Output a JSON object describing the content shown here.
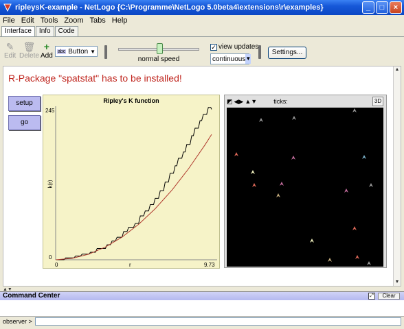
{
  "window": {
    "title": "ripleysK-example - NetLogo {C:\\Programme\\NetLogo 5.0beta4\\extensions\\r\\examples}"
  },
  "menu": [
    "File",
    "Edit",
    "Tools",
    "Zoom",
    "Tabs",
    "Help"
  ],
  "tabs": [
    {
      "label": "Interface",
      "active": true
    },
    {
      "label": "Info",
      "active": false
    },
    {
      "label": "Code",
      "active": false
    }
  ],
  "toolbar": {
    "edit_label": "Edit",
    "delete_label": "Delete",
    "add_label": "Add",
    "widget_tag": "abc",
    "widget_type": "Button",
    "speed_label": "normal speed",
    "speed_level": 0.5,
    "view_updates_label": "view updates",
    "view_updates_checked": true,
    "update_mode": "continuous",
    "settings_label": "Settings..."
  },
  "interface": {
    "error_message": "R-Package \"spatstat\" has to be installed!",
    "setup_label": "setup",
    "go_label": "go"
  },
  "chart_data": {
    "type": "line",
    "title": "Ripley's K function",
    "xlabel": "r",
    "ylabel": "k(r)",
    "xlim": [
      0,
      9.73
    ],
    "ylim": [
      0,
      245
    ],
    "x_min_label": "0",
    "x_max_label": "9.73",
    "y_min_label": "0",
    "y_max_label": "245",
    "series": [
      {
        "values": [
          [
            0,
            0
          ],
          [
            0.5,
            0
          ],
          [
            0.6,
            3
          ],
          [
            1.1,
            3
          ],
          [
            1.2,
            6
          ],
          [
            1.5,
            6
          ],
          [
            1.6,
            9
          ],
          [
            2.0,
            9
          ],
          [
            2.1,
            12
          ],
          [
            2.4,
            12
          ],
          [
            2.5,
            18
          ],
          [
            3.0,
            18
          ],
          [
            3.1,
            24
          ],
          [
            3.3,
            24
          ],
          [
            3.4,
            30
          ],
          [
            3.6,
            30
          ],
          [
            3.7,
            36
          ],
          [
            4.0,
            36
          ],
          [
            4.1,
            45
          ],
          [
            4.3,
            45
          ],
          [
            4.4,
            52
          ],
          [
            4.7,
            52
          ],
          [
            4.8,
            58
          ],
          [
            5.0,
            58
          ],
          [
            5.1,
            70
          ],
          [
            5.3,
            70
          ],
          [
            5.4,
            78
          ],
          [
            5.6,
            78
          ],
          [
            5.7,
            88
          ],
          [
            5.9,
            88
          ],
          [
            6.0,
            98
          ],
          [
            6.2,
            98
          ],
          [
            6.3,
            110
          ],
          [
            6.5,
            110
          ],
          [
            6.6,
            124
          ],
          [
            6.8,
            124
          ],
          [
            6.9,
            138
          ],
          [
            7.1,
            138
          ],
          [
            7.2,
            150
          ],
          [
            7.3,
            150
          ],
          [
            7.4,
            162
          ],
          [
            7.6,
            162
          ],
          [
            7.7,
            172
          ],
          [
            7.8,
            172
          ],
          [
            7.9,
            184
          ],
          [
            8.1,
            184
          ],
          [
            8.2,
            198
          ],
          [
            8.3,
            198
          ],
          [
            8.4,
            210
          ],
          [
            8.6,
            210
          ],
          [
            8.7,
            222
          ],
          [
            8.8,
            222
          ],
          [
            8.9,
            232
          ],
          [
            9.1,
            232
          ],
          [
            9.2,
            243
          ],
          [
            9.35,
            243
          ],
          [
            9.4,
            240
          ]
        ],
        "color": "#000000"
      },
      {
        "values": [
          [
            0,
            0
          ],
          [
            1,
            2.3
          ],
          [
            2,
            9
          ],
          [
            3,
            20.4
          ],
          [
            4,
            36.2
          ],
          [
            5,
            56.6
          ],
          [
            6,
            81.5
          ],
          [
            7,
            110.9
          ],
          [
            8,
            144.9
          ],
          [
            9,
            183.4
          ],
          [
            9.4,
            200
          ]
        ],
        "color": "#b03a2e"
      }
    ]
  },
  "world": {
    "ticks_label": "ticks:",
    "btn_3d": "3D",
    "agent_colors": [
      "#9a9a9a",
      "#f3f3c0",
      "#e06a5a",
      "#c86fa0",
      "#7ab0c8",
      "#c8b080",
      "#6a8ae0"
    ]
  },
  "command_center": {
    "title": "Command Center",
    "clear_label": "Clear",
    "prompt_label": "observer >"
  }
}
